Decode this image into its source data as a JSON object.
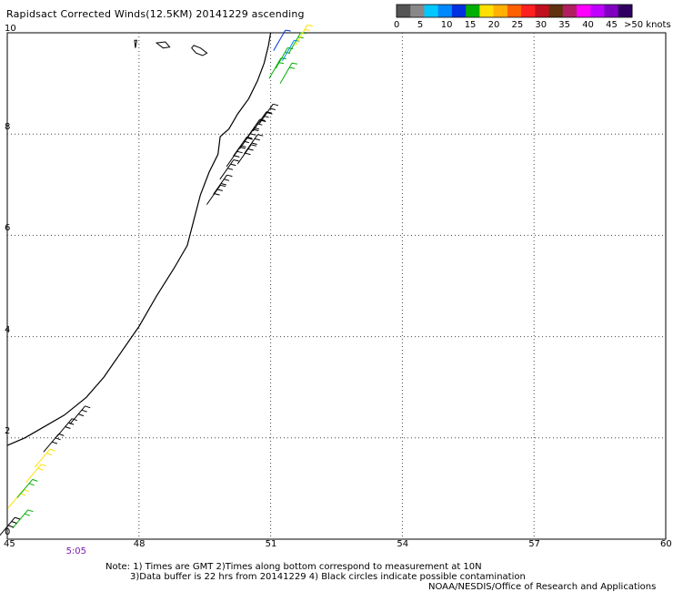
{
  "title": "Rapidsact Corrected Winds(12.5KM) 20141229 ascending",
  "map": {
    "x_ticks": [
      45,
      48,
      51,
      54,
      57,
      60
    ],
    "y_ticks": [
      0,
      2,
      4,
      6,
      8,
      10
    ],
    "x_range": [
      45,
      60
    ],
    "y_range": [
      0,
      10
    ],
    "grid": true,
    "grid_style": "dotted"
  },
  "legend": {
    "labels": [
      "0",
      "5",
      "10",
      "15",
      "20",
      "25",
      "30",
      "35",
      "40",
      "45",
      ">50 knots"
    ],
    "colors": [
      "#555555",
      "#888888",
      "#00c8ff",
      "#0088ff",
      "#0030e0",
      "#00b000",
      "#ffe000",
      "#ffb000",
      "#ff6000",
      "#ff2020",
      "#c01020",
      "#603010",
      "#b02060",
      "#ff00ff",
      "#c000ff",
      "#8000c0",
      "#300060"
    ]
  },
  "time_labels": [
    {
      "text": "5:05",
      "lon": 46.4
    }
  ],
  "notes": {
    "line1": "Note: 1) Times are GMT 2)Times along bottom correspond to measurement at 10N",
    "line2": "3)Data buffer is 22 hrs from 20141229 4) Black circles indicate possible contamination",
    "line3": "NOAA/NESDIS/Office of Research and Applications"
  },
  "coastline": [
    [
      45.0,
      1.85
    ],
    [
      45.4,
      2.0
    ],
    [
      45.8,
      2.2
    ],
    [
      46.3,
      2.45
    ],
    [
      46.8,
      2.8
    ],
    [
      47.2,
      3.2
    ],
    [
      47.6,
      3.7
    ],
    [
      48.0,
      4.2
    ],
    [
      48.4,
      4.8
    ],
    [
      48.8,
      5.35
    ],
    [
      49.1,
      5.8
    ],
    [
      49.25,
      6.3
    ],
    [
      49.4,
      6.8
    ],
    [
      49.6,
      7.25
    ],
    [
      49.8,
      7.6
    ],
    [
      49.85,
      7.95
    ],
    [
      50.05,
      8.1
    ],
    [
      50.25,
      8.4
    ],
    [
      50.5,
      8.7
    ],
    [
      50.7,
      9.05
    ],
    [
      50.85,
      9.4
    ],
    [
      50.95,
      9.75
    ],
    [
      51.0,
      10.0
    ]
  ],
  "islands": [
    [
      [
        47.9,
        9.85
      ],
      [
        47.92,
        9.7
      ],
      [
        47.95,
        9.85
      ]
    ],
    [
      [
        49.2,
        9.7
      ],
      [
        49.3,
        9.6
      ],
      [
        49.45,
        9.55
      ],
      [
        49.55,
        9.6
      ],
      [
        49.4,
        9.7
      ],
      [
        49.25,
        9.75
      ]
    ],
    [
      [
        48.4,
        9.8
      ],
      [
        48.55,
        9.7
      ],
      [
        48.7,
        9.72
      ],
      [
        48.6,
        9.82
      ]
    ]
  ],
  "wind_barbs": [
    {
      "lon": 49.7,
      "lat": 6.8,
      "dir": 35,
      "speed": 25
    },
    {
      "lon": 49.85,
      "lat": 7.0,
      "dir": 35,
      "speed": 25
    },
    {
      "lon": 50.0,
      "lat": 7.3,
      "dir": 35,
      "speed": 25
    },
    {
      "lon": 50.15,
      "lat": 7.55,
      "dir": 35,
      "speed": 25
    },
    {
      "lon": 50.3,
      "lat": 7.75,
      "dir": 35,
      "speed": 25
    },
    {
      "lon": 50.45,
      "lat": 7.9,
      "dir": 35,
      "speed": 25
    },
    {
      "lon": 50.6,
      "lat": 8.1,
      "dir": 35,
      "speed": 25
    },
    {
      "lon": 50.75,
      "lat": 8.25,
      "dir": 35,
      "speed": 25
    },
    {
      "lon": 50.9,
      "lat": 8.4,
      "dir": 35,
      "speed": 25
    },
    {
      "lon": 50.4,
      "lat": 7.6,
      "dir": 35,
      "speed": 25
    },
    {
      "lon": 50.55,
      "lat": 7.8,
      "dir": 35,
      "speed": 25
    },
    {
      "lon": 51.1,
      "lat": 9.3,
      "dir": 30,
      "speed": 15,
      "color": "#00b000"
    },
    {
      "lon": 51.25,
      "lat": 9.5,
      "dir": 30,
      "speed": 15,
      "color": "#00b000"
    },
    {
      "lon": 51.4,
      "lat": 9.65,
      "dir": 30,
      "speed": 10,
      "color": "#0088ff"
    },
    {
      "lon": 51.55,
      "lat": 9.8,
      "dir": 30,
      "speed": 15,
      "color": "#00b000"
    },
    {
      "lon": 51.7,
      "lat": 9.95,
      "dir": 30,
      "speed": 15,
      "color": "#ffe000"
    },
    {
      "lon": 51.2,
      "lat": 9.85,
      "dir": 30,
      "speed": 10,
      "color": "#0030e0"
    },
    {
      "lon": 51.35,
      "lat": 9.2,
      "dir": 30,
      "speed": 20,
      "color": "#00b000"
    },
    {
      "lon": 45.2,
      "lat": 0.8,
      "dir": 40,
      "speed": 15,
      "color": "#ffe000"
    },
    {
      "lon": 45.4,
      "lat": 1.0,
      "dir": 40,
      "speed": 15,
      "color": "#00b000"
    },
    {
      "lon": 45.6,
      "lat": 1.3,
      "dir": 40,
      "speed": 15,
      "color": "#ffe000"
    },
    {
      "lon": 45.8,
      "lat": 1.6,
      "dir": 40,
      "speed": 15,
      "color": "#ffe000"
    },
    {
      "lon": 46.0,
      "lat": 1.9,
      "dir": 40,
      "speed": 25
    },
    {
      "lon": 46.3,
      "lat": 2.2,
      "dir": 40,
      "speed": 25
    },
    {
      "lon": 46.6,
      "lat": 2.45,
      "dir": 40,
      "speed": 25
    },
    {
      "lon": 45.3,
      "lat": 0.4,
      "dir": 40,
      "speed": 15,
      "color": "#00b000"
    },
    {
      "lon": 45.0,
      "lat": 0.25,
      "dir": 40,
      "speed": 25
    }
  ]
}
